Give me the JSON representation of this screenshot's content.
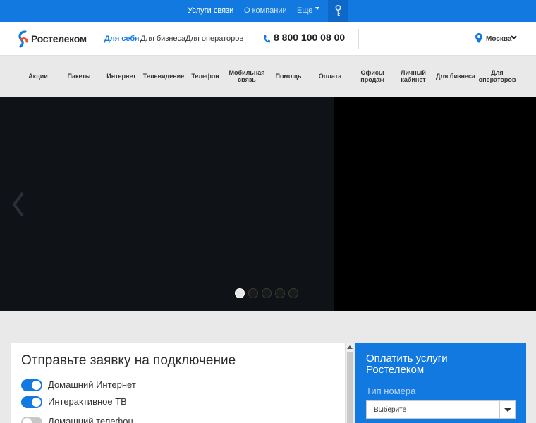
{
  "topbar": {
    "links": [
      "Услуги связи",
      "О компании"
    ],
    "more_label": "Еще",
    "colors": {
      "background": "#1279e0"
    }
  },
  "header": {
    "brand": "Ростелеком",
    "segments": [
      "Для себя",
      "Для бизнеса",
      "Для операторов"
    ],
    "phone": "8 800 100 08 00",
    "city": "Москва"
  },
  "nav": {
    "items": [
      "Акции",
      "Пакеты",
      "Интернет",
      "Телевидение",
      "Телефон",
      "Мобильная связь",
      "Помощь",
      "Оплата",
      "Офисы продаж",
      "Личный кабинет",
      "Для бизнеса",
      "Для операторов"
    ]
  },
  "hero": {
    "slides_count": 5,
    "active_slide": 1
  },
  "application_form": {
    "title": "Отправьте заявку на подключение",
    "services": [
      {
        "label": "Домашний Интернет",
        "enabled": true
      },
      {
        "label": "Интерактивное ТВ",
        "enabled": true
      },
      {
        "label": "Домашний телефон",
        "enabled": false
      }
    ]
  },
  "payment": {
    "title": "Оплатить услуги Ростелеком",
    "number_type_label": "Тип номера",
    "select_value": "Выберите"
  }
}
